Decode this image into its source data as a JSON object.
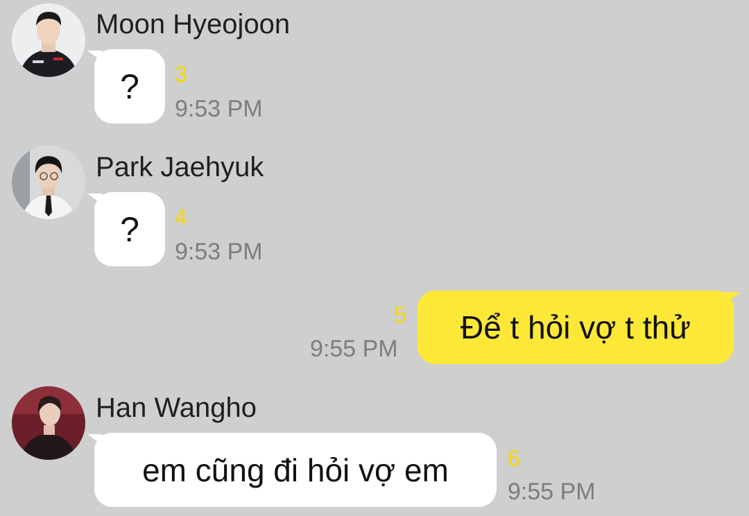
{
  "messages": [
    {
      "sender": "Moon Hyeojoon",
      "text": "?",
      "unread": "3",
      "time": "9:53 PM",
      "mine": false
    },
    {
      "sender": "Park Jaehyuk",
      "text": "?",
      "unread": "4",
      "time": "9:53 PM",
      "mine": false
    },
    {
      "sender": "",
      "text": "Để t hỏi vợ t thử",
      "unread": "5",
      "time": "9:55 PM",
      "mine": true
    },
    {
      "sender": "Han Wangho",
      "text": "em cũng đi hỏi vợ em",
      "unread": "6",
      "time": "9:55 PM",
      "mine": false
    }
  ],
  "colors": {
    "background": "#cfcfcf",
    "mine_bubble": "#fde838",
    "their_bubble": "#ffffff",
    "unread": "#f5d800",
    "time": "#7d7d7d"
  },
  "icons": [
    "profile-avatar-moon-hyeojoon",
    "profile-avatar-park-jaehyuk",
    "profile-avatar-han-wangho"
  ]
}
